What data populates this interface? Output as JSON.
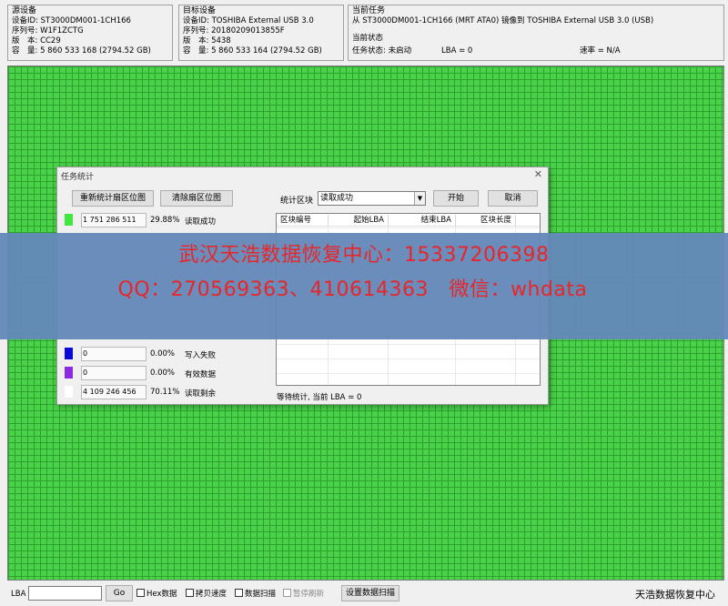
{
  "source": {
    "title": "源设备",
    "device_id": "设备ID: ST3000DM001-1CH166",
    "serial": "序列号: W1F1ZCTG",
    "version": "版　本: CC29",
    "capacity": "容　量: 5 860 533 168 (2794.52 GB)"
  },
  "target": {
    "title": "目标设备",
    "device_id": "设备ID: TOSHIBA External USB 3.0",
    "serial": "序列号: 20180209013855F",
    "version": "版　本: 5438",
    "capacity": "容　量: 5 860 533 164 (2794.52 GB)"
  },
  "current_task": {
    "title": "当前任务",
    "description": "从 ST3000DM001-1CH166 (MRT ATA0) 镜像到 TOSHIBA External USB 3.0 (USB)",
    "status_title": "当前状态",
    "task_status": "任务状态: 未启动",
    "lba": "LBA = 0",
    "rate": "速率 = N/A"
  },
  "dialog": {
    "title": "任务统计",
    "close": "✕",
    "rebuild_button": "重新统计扇区位图",
    "clear_button": "清除扇区位图",
    "region_label": "统计区块",
    "region_selected": "读取成功",
    "start_button": "开始",
    "cancel_button": "取消",
    "stats": [
      {
        "count": "1 751 286 511",
        "percent": "29.88%",
        "label": "读取成功",
        "color": "#3ee83e"
      },
      {
        "count": "0",
        "percent": "0.00%",
        "label": "写入失败",
        "color": "#0a0ad8"
      },
      {
        "count": "0",
        "percent": "0.00%",
        "label": "有效数据",
        "color": "#8a2be2"
      },
      {
        "count": "4 109 246 456",
        "percent": "70.11%",
        "label": "读取剩余",
        "color": "#ffffff"
      }
    ],
    "table_headers": [
      "区块编号",
      "起始LBA",
      "结束LBA",
      "区块长度"
    ],
    "wait_text": "等待统计, 当前 LBA = 0"
  },
  "banner": {
    "line1": "武汉天浩数据恢复中心：15337206398",
    "line2": "QQ：270569363、410614363　微信：whdata",
    "color": "#e8262a"
  },
  "bottom": {
    "lba_label": "LBA",
    "go_button": "Go",
    "hex_label": "Hex数据",
    "copy_speed_label": "拷贝速度",
    "data_scan_label": "数据扫描",
    "pause_refresh_label": "暂停刷新",
    "set_scan_button": "设置数据扫描",
    "brand": "天浩数据恢复中心"
  },
  "colors": {
    "sector_ok": "#4ad24a",
    "sector_grid": "#2ea02e",
    "banner_bg": "#6488b8"
  }
}
